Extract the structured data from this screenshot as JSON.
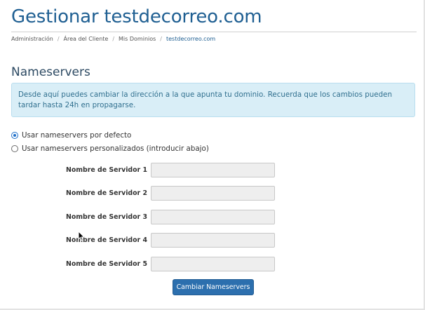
{
  "header": {
    "title": "Gestionar testdecorreo.com"
  },
  "breadcrumb": {
    "items": [
      "Administración",
      "Área del Cliente",
      "Mis Dominios"
    ],
    "active": "testdecorreo.com",
    "separator": "/"
  },
  "nameservers": {
    "section_title": "Nameservers",
    "info_text": "Desde aquí puedes cambiar la dirección a la que apunta tu dominio. Recuerda que los cambios pueden tardar hasta 24h en propagarse.",
    "options": [
      {
        "label": "Usar nameservers por defecto",
        "selected": true
      },
      {
        "label": "Usar nameservers personalizados (introducir abajo)",
        "selected": false
      }
    ],
    "fields": [
      {
        "label": "Nombre de Servidor 1",
        "value": ""
      },
      {
        "label": "Nombre de Servidor 2",
        "value": ""
      },
      {
        "label": "Nombre de Servidor 3",
        "value": ""
      },
      {
        "label": "Nombre de Servidor 4",
        "value": ""
      },
      {
        "label": "Nombre de Servidor 5",
        "value": ""
      }
    ],
    "submit_label": "Cambiar Nameservers"
  },
  "colors": {
    "title": "#1f5f92",
    "info_bg": "#d9eef7",
    "info_text": "#31708f",
    "button_bg": "#2c6fae"
  }
}
